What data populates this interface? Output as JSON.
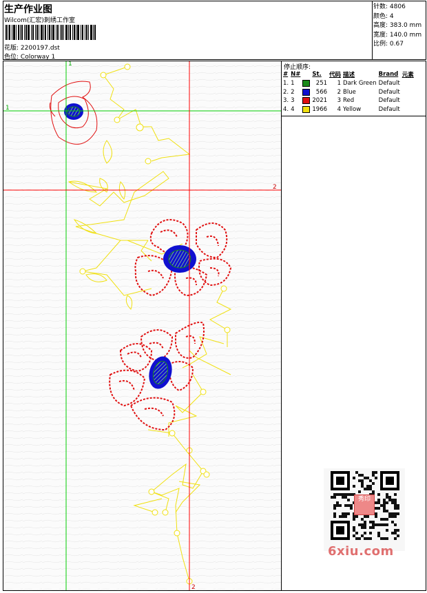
{
  "header": {
    "title": "生产作业图",
    "company": "Wilcom(汇宏)刺绣工作室",
    "design_label": "花版:",
    "design_value": "2200197.dst",
    "colorway_label": "色位:",
    "colorway_value": "Colorway 1"
  },
  "stats": {
    "stitches_label": "针数:",
    "stitches_value": "4806",
    "colors_label": "颜色:",
    "colors_value": "4",
    "height_label": "高度:",
    "height_value": "383.0 mm",
    "width_label": "宽度:",
    "width_value": "140.0 mm",
    "scale_label": "比例:",
    "scale_value": "0.67"
  },
  "stop_sequence": {
    "title": "停止顺序:",
    "columns": [
      "#",
      "N#",
      "St.",
      "代码",
      "描述",
      "Brand",
      "元素"
    ],
    "rows": [
      {
        "num": "1.",
        "n": "1",
        "color": "#1a8a1a",
        "stitches": "251",
        "code": "1",
        "desc": "Dark Green",
        "brand": "Default"
      },
      {
        "num": "2.",
        "n": "2",
        "color": "#1010d0",
        "stitches": "566",
        "code": "2",
        "desc": "Blue",
        "brand": "Default"
      },
      {
        "num": "3.",
        "n": "3",
        "color": "#e01010",
        "stitches": "2021",
        "code": "3",
        "desc": "Red",
        "brand": "Default"
      },
      {
        "num": "4.",
        "n": "4",
        "color": "#f0e010",
        "stitches": "1966",
        "code": "4",
        "desc": "Yellow",
        "brand": "Default"
      }
    ]
  },
  "guides": {
    "v1_label": "1",
    "h1_label": "1",
    "h2_label": "2",
    "v2_label": "2"
  },
  "thread_colors": {
    "green": "#1a8a1a",
    "blue": "#1010d0",
    "red": "#e01010",
    "yellow": "#f0e010",
    "guide_green": "#00cc00",
    "guide_red": "#ff0000"
  },
  "watermark": "6xiu.com",
  "qr_stamp_text": "秀印"
}
